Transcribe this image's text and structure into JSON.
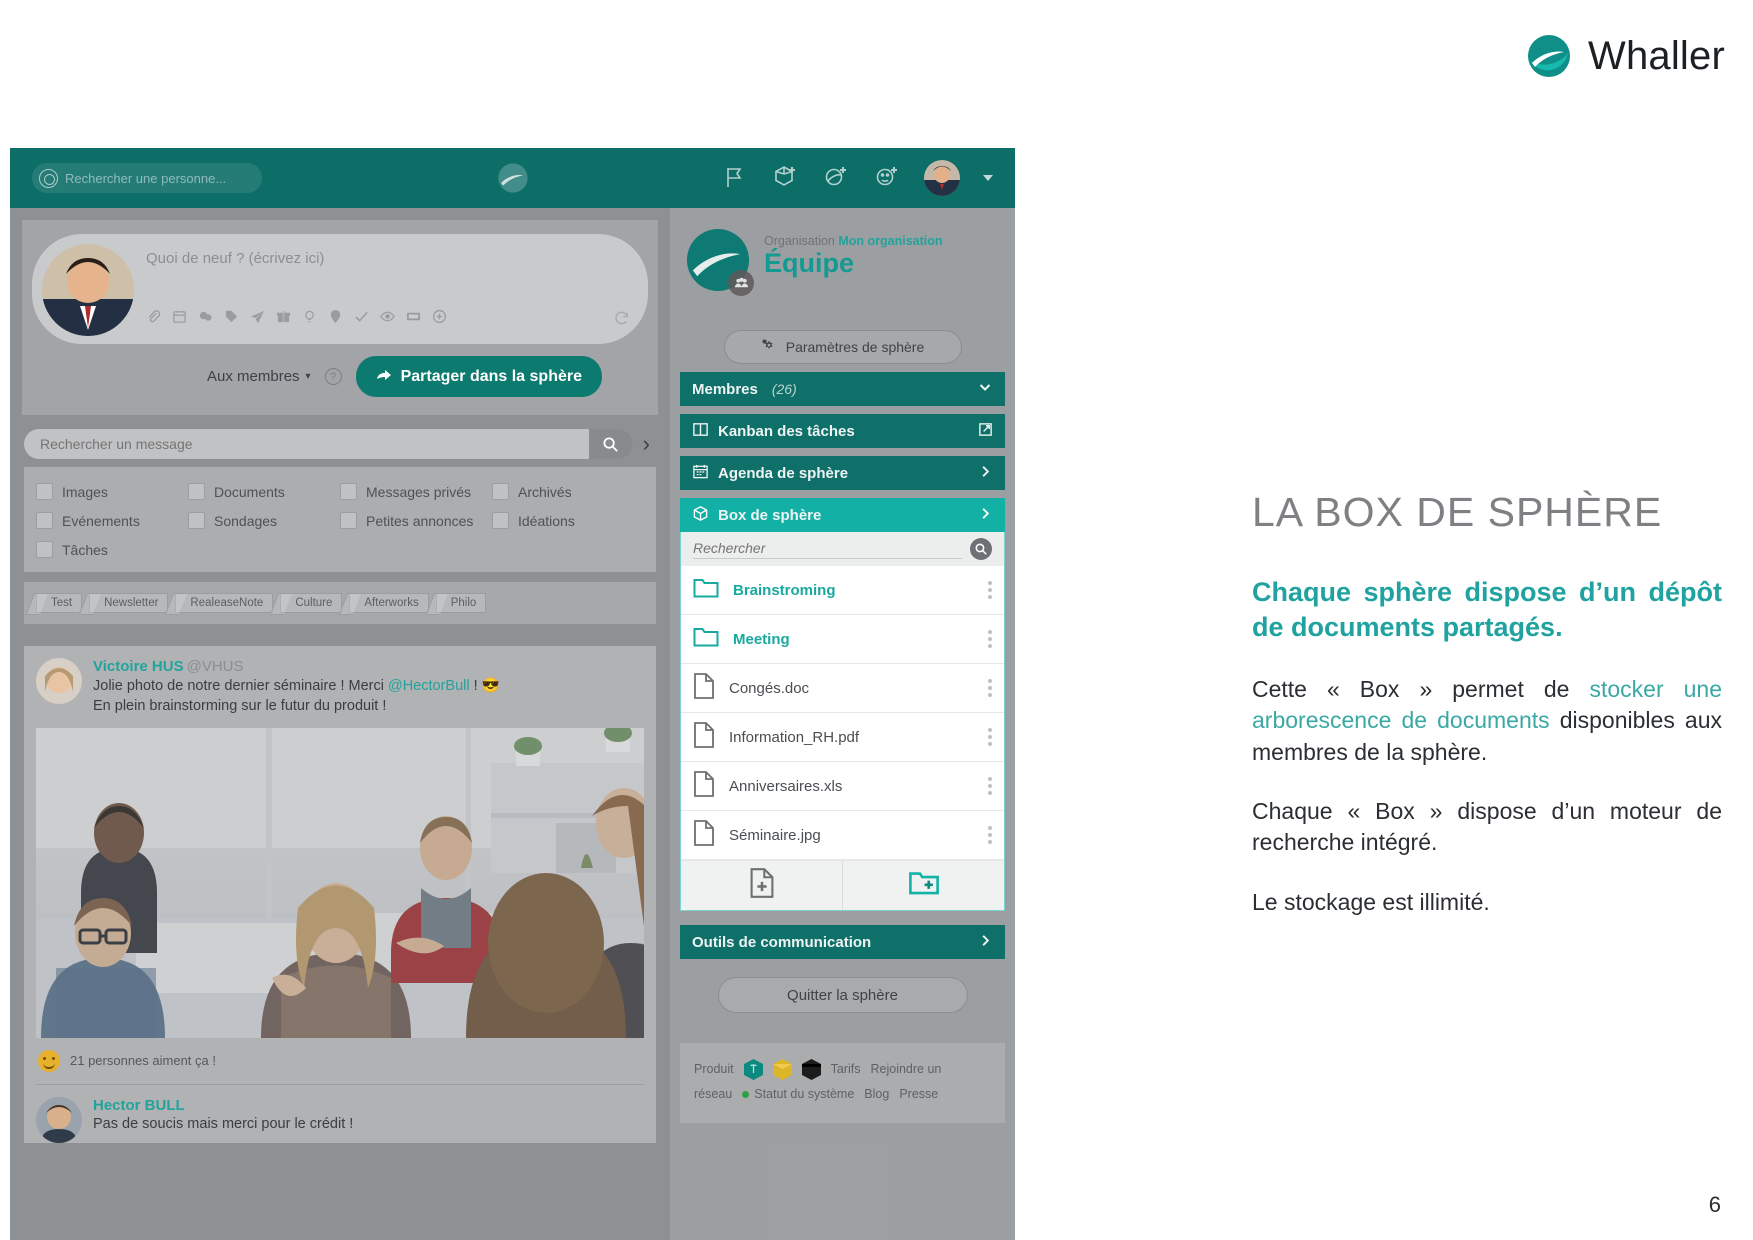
{
  "brand": {
    "name": "Whaller",
    "logo_icon": "whaller-sphere-logo"
  },
  "slide": {
    "title": "LA BOX DE SPHÈRE",
    "lead": "Chaque sphère dispose d’un dépôt de documents partagés.",
    "paragraphs": [
      {
        "before": "Cette « Box » permet de ",
        "highlight": "stocker une arborescence de documents",
        "after": " disponibles aux membres de la sphère."
      },
      {
        "before": "Chaque « Box » dispose d’un moteur de recherche intégré.",
        "highlight": "",
        "after": ""
      },
      {
        "before": "Le stockage est illimité.",
        "highlight": "",
        "after": ""
      }
    ],
    "page_number": "6",
    "accent_teal": "#20a3a0",
    "title_gray": "#7e8083"
  },
  "app": {
    "topbar": {
      "search_placeholder": "Rechercher une personne...",
      "search_icon": "search-circle-icon",
      "logo_icon": "whaller-sphere-logo",
      "icons": [
        "flag-icon",
        "create-sphere-icon",
        "create-network-icon",
        "invite-person-icon"
      ],
      "avatar": "user-avatar",
      "caret_icon": "chevron-down-icon"
    },
    "composer": {
      "placeholder": "Quoi de neuf ? (écrivez ici)",
      "avatar": "current-user-avatar",
      "tool_icons": [
        "attach-icon",
        "calendar-icon",
        "poll-icon",
        "tag-icon",
        "send-icon",
        "gift-icon",
        "idea-icon",
        "location-icon",
        "check-icon",
        "eye-icon",
        "media-icon",
        "plus-circle-icon"
      ],
      "refresh_icon": "refresh-icon",
      "audience_label": "Aux membres",
      "audience_caret": "chevron-down-icon",
      "help_label": "?",
      "share_label": "Partager dans la sphère",
      "share_icon": "share-arrow-icon"
    },
    "message_search": {
      "placeholder": "Rechercher un message",
      "value": "",
      "search_icon": "magnifier-icon",
      "expand_icon": "chevron-right-icon"
    },
    "filters": [
      [
        "Images",
        "Documents",
        "Messages privés",
        "Archivés"
      ],
      [
        "Evénements",
        "Sondages",
        "Petites annonces",
        "Idéations"
      ],
      [
        "Tâches"
      ]
    ],
    "tags": [
      "Test",
      "Newsletter",
      "RealeaseNote",
      "Culture",
      "Afterworks",
      "Philo"
    ],
    "post": {
      "author": "Victoire HUS",
      "handle": "@VHUS",
      "text_before": "Jolie photo de notre dernier séminaire ! Merci ",
      "mention": "@HectorBull",
      "text_after": " ! 😎",
      "text_line2": "En plein brainstorming sur le futur du produit !",
      "photo_alt": "office-brainstorming-photo",
      "likes": "21 personnes aiment ça !",
      "like_icon": "smiley-like-icon"
    },
    "reply": {
      "author": "Hector BULL",
      "text": "Pas de soucis mais merci pour le crédit !"
    },
    "sphere": {
      "org_label": "Organisation",
      "org_name": "Mon organisation",
      "name": "Équipe",
      "logo_icon": "sphere-logo",
      "badge_icon": "group-badge-icon",
      "settings_label": "Paramètres de sphère",
      "settings_icon": "gear-icon",
      "rows": [
        {
          "label": "Membres",
          "count": "(26)",
          "icon": "",
          "right_icon": "chevron-down-icon",
          "active": false
        },
        {
          "label": "Kanban des tâches",
          "count": "",
          "icon": "kanban-icon",
          "right_icon": "external-link-icon",
          "active": false
        },
        {
          "label": "Agenda de sphère",
          "count": "",
          "icon": "calendar-icon",
          "right_icon": "chevron-right-icon",
          "active": false
        },
        {
          "label": "Box de sphère",
          "count": "",
          "icon": "box-icon",
          "right_icon": "chevron-right-icon",
          "active": true
        }
      ],
      "box": {
        "search_placeholder": "Rechercher",
        "search_icon": "magnifier-icon",
        "items": [
          {
            "name": "Brainstroming",
            "type": "folder",
            "menu_icon": "kebab-menu-icon"
          },
          {
            "name": "Meeting",
            "type": "folder",
            "menu_icon": "kebab-menu-icon"
          },
          {
            "name": "Congés.doc",
            "type": "file",
            "menu_icon": "kebab-menu-icon"
          },
          {
            "name": "Information_RH.pdf",
            "type": "file",
            "menu_icon": "kebab-menu-icon"
          },
          {
            "name": "Anniversaires.xls",
            "type": "file",
            "menu_icon": "kebab-menu-icon"
          },
          {
            "name": "Séminaire.jpg",
            "type": "file",
            "menu_icon": "kebab-menu-icon"
          }
        ],
        "add_file_icon": "add-file-icon",
        "add_folder_icon": "add-folder-icon"
      },
      "tools_row": {
        "label": "Outils de communication",
        "right_icon": "chevron-right-icon"
      },
      "quit_label": "Quitter la sphère",
      "footer": {
        "links_line1": [
          "Produit",
          "Tarifs",
          "Rejoindre un"
        ],
        "links_line2": [
          "réseau",
          "Statut du système",
          "Blog",
          "Presse"
        ],
        "status_dot_color": "#2f9e44",
        "cubes": [
          "teal-cube-icon",
          "yellow-cube-icon",
          "black-cube-icon"
        ]
      }
    },
    "colors": {
      "topbar": "#0d6e68",
      "row": "#0f706a",
      "row_active": "#13b0a5",
      "folder": "#18a99f"
    }
  }
}
